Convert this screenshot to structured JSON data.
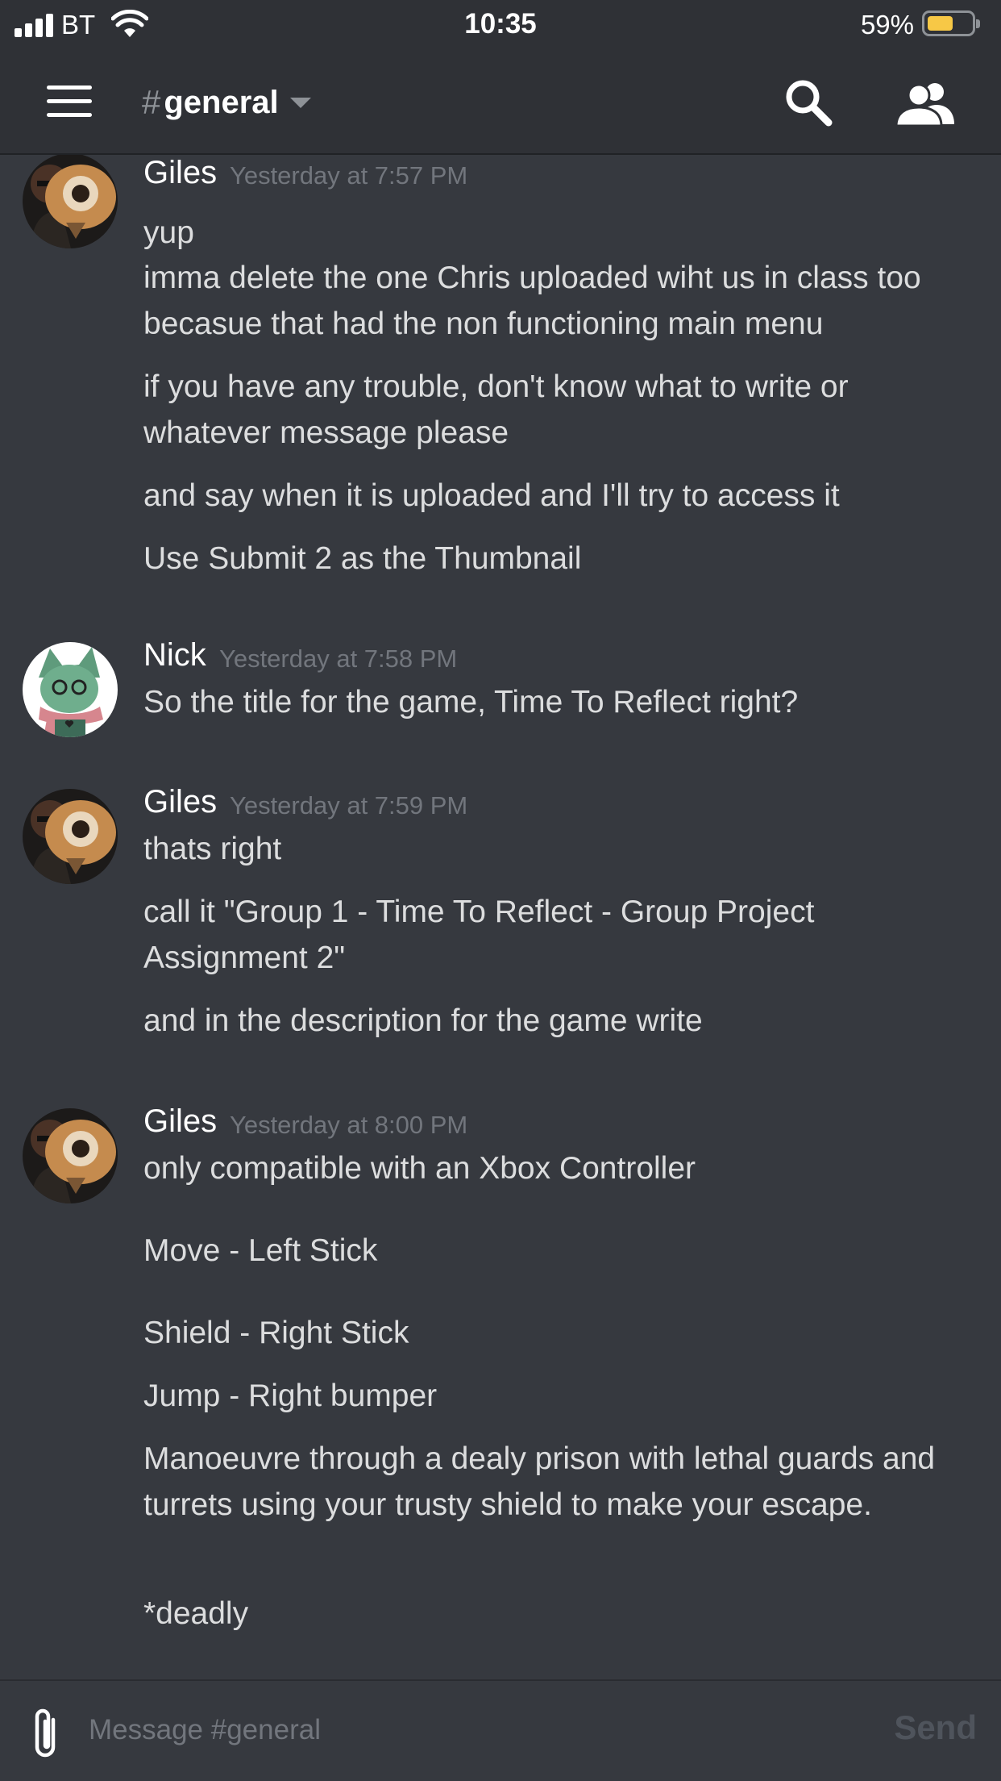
{
  "status_bar": {
    "carrier": "BT",
    "time": "10:35",
    "battery_percent": "59%",
    "battery_level": 0.59,
    "battery_color": "#f7c846",
    "icons": [
      "cellular-signal-icon",
      "wifi-icon",
      "battery-icon"
    ]
  },
  "header": {
    "channel_hash": "#",
    "channel_name": "general",
    "icons": [
      "menu-icon",
      "channel-dropdown-icon",
      "search-icon",
      "members-icon"
    ]
  },
  "messages": [
    {
      "author": "Giles",
      "timestamp": "Yesterday at 7:57 PM",
      "avatar": "giles-avatar",
      "lines": [
        "yup",
        "imma delete the one Chris uploaded wiht us in class too becasue that had the non functioning main menu",
        "if you have any trouble, don't know what to write or whatever message please",
        "and say when it is uploaded and I'll try to access it",
        "Use Submit 2 as the Thumbnail"
      ]
    },
    {
      "author": "Nick",
      "timestamp": "Yesterday at 7:58 PM",
      "avatar": "nick-avatar",
      "lines": [
        "So the title for the game, Time To Reflect right?"
      ]
    },
    {
      "author": "Giles",
      "timestamp": "Yesterday at 7:59 PM",
      "avatar": "giles-avatar",
      "lines": [
        "thats right",
        "call it \"Group 1 - Time To Reflect - Group Project Assignment 2\"",
        "and in the description for the game write"
      ]
    },
    {
      "author": "Giles",
      "timestamp": "Yesterday at 8:00 PM",
      "avatar": "giles-avatar",
      "lines": [
        "only compatible with an Xbox Controller",
        "Move - Left Stick",
        "Shield - Right Stick",
        "Jump - Right bumper",
        "Manoeuvre through a dealy prison with lethal guards and turrets using your trusty shield to make your escape.",
        "*deadly"
      ]
    }
  ],
  "composer": {
    "placeholder": "Message #general",
    "value": "",
    "send_label": "Send",
    "attach_icon": "paperclip-icon"
  },
  "colors": {
    "background": "#36393f",
    "header_background": "#2f3136",
    "text": "#dcddde",
    "author": "#ffffff",
    "timestamp": "#72767d"
  }
}
